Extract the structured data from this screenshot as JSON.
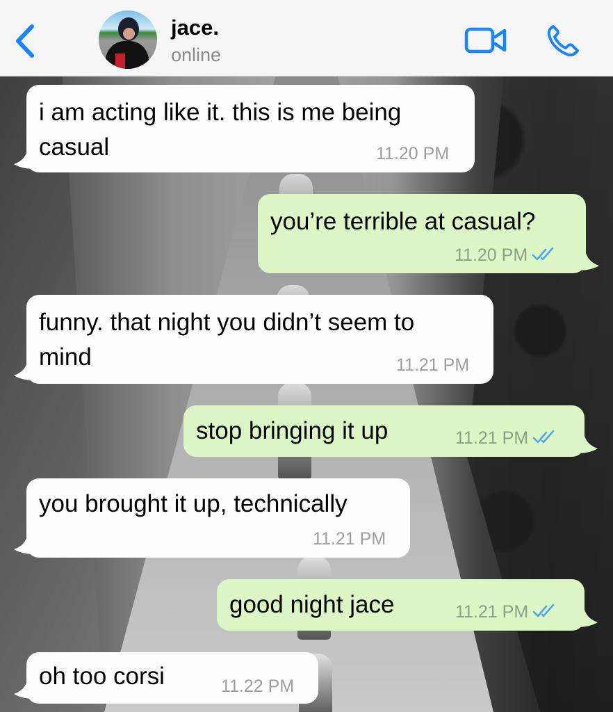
{
  "contact": {
    "name": "jace.",
    "status": "online"
  },
  "icons": {
    "back": "chevron-left-icon",
    "video": "video-call-icon",
    "phone": "phone-call-icon",
    "read_receipt": "double-check-icon"
  },
  "colors": {
    "accent": "#1a84ff",
    "incoming_bubble": "#fefefe",
    "outgoing_bubble": "#dcf7c5",
    "read_tick": "#4fa6ea"
  },
  "messages": [
    {
      "direction": "in",
      "lines": [
        "i am acting like it. this is me being",
        "casual"
      ],
      "time": "11.20 PM"
    },
    {
      "direction": "out",
      "lines": [
        "you’re terrible at casual?"
      ],
      "time": "11.20 PM"
    },
    {
      "direction": "in",
      "lines": [
        "funny. that night you didn’t seem to",
        "mind"
      ],
      "time": "11.21 PM"
    },
    {
      "direction": "out",
      "lines": [
        "stop bringing it up"
      ],
      "time": "11.21 PM"
    },
    {
      "direction": "in",
      "lines": [
        "you brought it up, technically"
      ],
      "time": "11.21 PM"
    },
    {
      "direction": "out",
      "lines": [
        "good night jace"
      ],
      "time": "11.21 PM"
    },
    {
      "direction": "in",
      "lines": [
        "oh too corsi"
      ],
      "time": "11.22 PM"
    }
  ]
}
